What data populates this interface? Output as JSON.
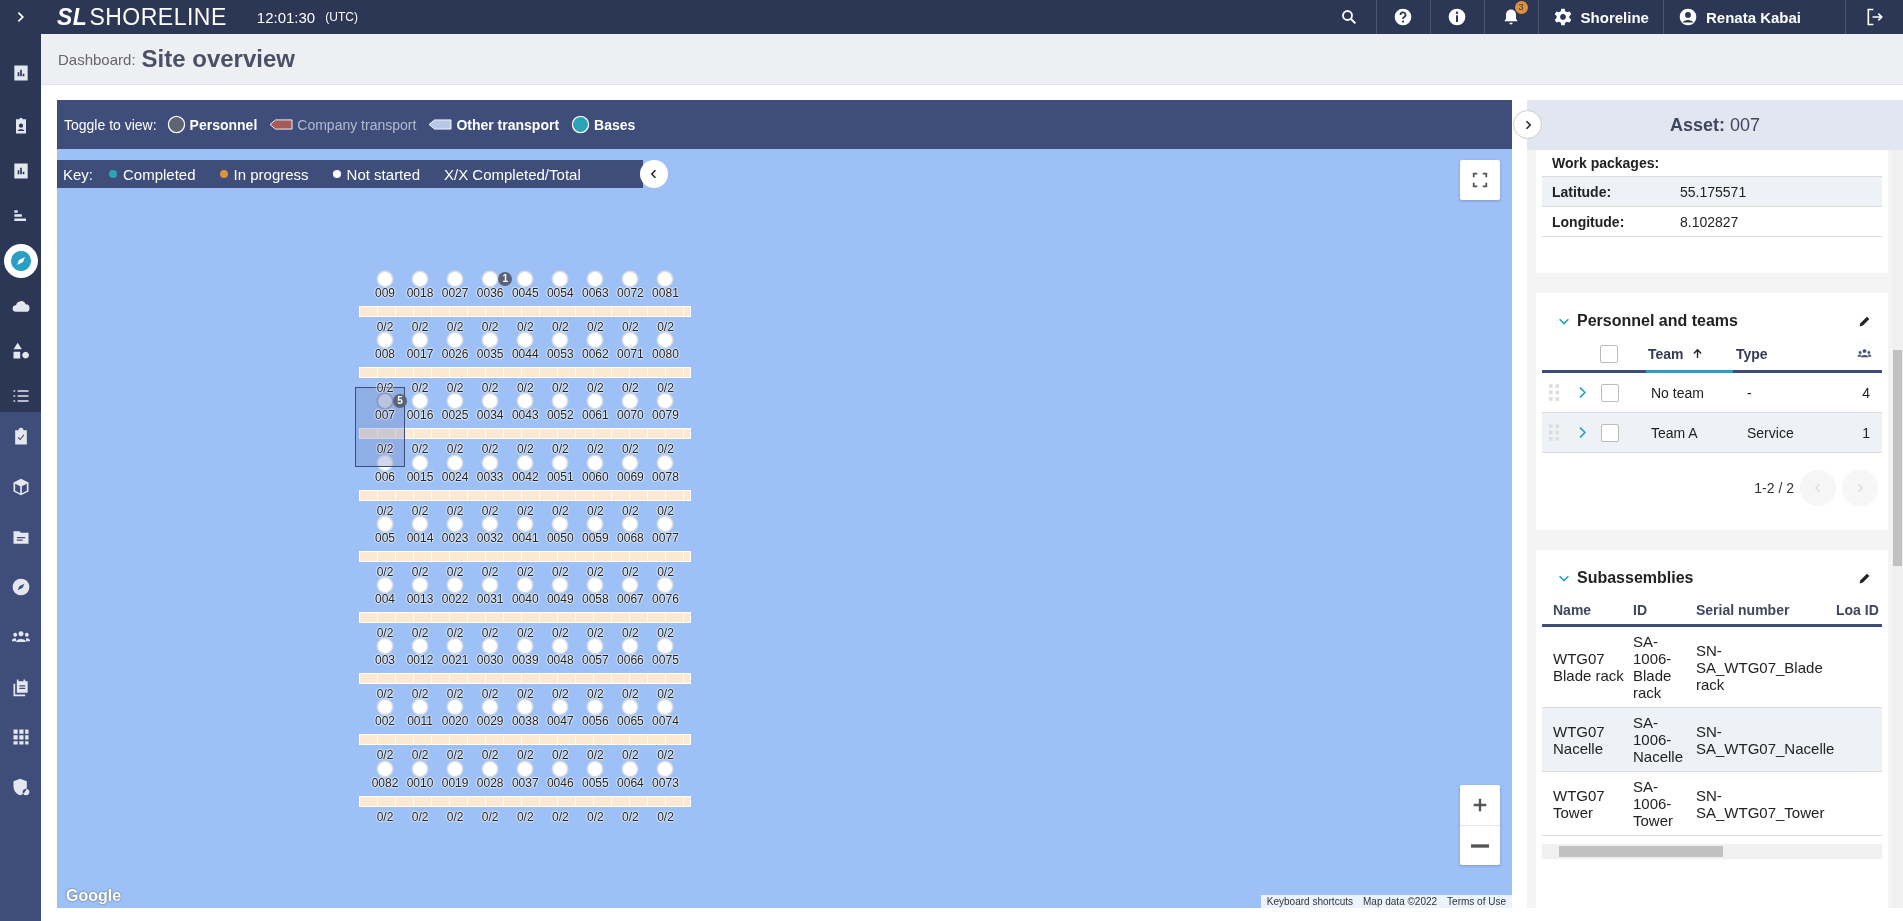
{
  "topbar": {
    "logo_mark": "SL",
    "logo_text": "SHORELINE",
    "time": "12:01:30",
    "timezone": "(UTC)",
    "notifications_count": "3",
    "organization": "Shoreline",
    "user": "Renata Kabai"
  },
  "page_header": {
    "breadcrumb": "Dashboard:",
    "title": "Site overview"
  },
  "sidebar": {
    "items": [
      {
        "selected": false
      },
      {
        "selected": false
      },
      {
        "selected": false
      },
      {
        "selected": false
      },
      {
        "selected": true
      },
      {
        "selected": false
      },
      {
        "selected": false
      },
      {
        "selected": false
      },
      {
        "selected": false
      },
      {
        "selected": false
      },
      {
        "selected": false
      },
      {
        "selected": false
      },
      {
        "selected": false
      },
      {
        "selected": false
      },
      {
        "selected": false
      },
      {
        "selected": false
      }
    ]
  },
  "map_toolbar": {
    "label": "Toggle to view:",
    "toggles": [
      {
        "label": "Personnel",
        "kind": "circle",
        "color": "#5f6473",
        "on": true
      },
      {
        "label": "Company transport",
        "kind": "arrow",
        "color": "#a85a5a",
        "on": false
      },
      {
        "label": "Other transport",
        "kind": "arrow",
        "color": "#b8c7e6",
        "on": true
      },
      {
        "label": "Bases",
        "kind": "circle",
        "color": "#2aa3b4",
        "on": true
      }
    ]
  },
  "map": {
    "key": {
      "label": "Key:",
      "items": [
        {
          "label": "Completed",
          "color": "#2aa3b4"
        },
        {
          "label": "In progress",
          "color": "#e0923a"
        },
        {
          "label": "Not started",
          "color": "#ffffff"
        }
      ],
      "note": "X/X Completed/Total"
    },
    "rows": [
      {
        "turbines": [
          {
            "id": "009",
            "count": "0/2",
            "selected": false
          },
          {
            "id": "0018",
            "count": "0/2",
            "selected": false
          },
          {
            "id": "0027",
            "count": "0/2",
            "selected": false
          },
          {
            "id": "0036",
            "count": "0/2",
            "selected": false,
            "badge": "1"
          },
          {
            "id": "0045",
            "count": "0/2",
            "selected": false
          },
          {
            "id": "0054",
            "count": "0/2",
            "selected": false
          },
          {
            "id": "0063",
            "count": "0/2",
            "selected": false
          },
          {
            "id": "0072",
            "count": "0/2",
            "selected": false
          },
          {
            "id": "0081",
            "count": "0/2",
            "selected": false
          }
        ]
      },
      {
        "turbines": [
          {
            "id": "008",
            "count": "0/2",
            "selected": false
          },
          {
            "id": "0017",
            "count": "0/2",
            "selected": false
          },
          {
            "id": "0026",
            "count": "0/2",
            "selected": false
          },
          {
            "id": "0035",
            "count": "0/2",
            "selected": false
          },
          {
            "id": "0044",
            "count": "0/2",
            "selected": false
          },
          {
            "id": "0053",
            "count": "0/2",
            "selected": false
          },
          {
            "id": "0062",
            "count": "0/2",
            "selected": false
          },
          {
            "id": "0071",
            "count": "0/2",
            "selected": false
          },
          {
            "id": "0080",
            "count": "0/2",
            "selected": false
          }
        ]
      },
      {
        "turbines": [
          {
            "id": "007",
            "count": "0/2",
            "selected": true,
            "badge": "5"
          },
          {
            "id": "0016",
            "count": "0/2",
            "selected": false
          },
          {
            "id": "0025",
            "count": "0/2",
            "selected": false
          },
          {
            "id": "0034",
            "count": "0/2",
            "selected": false
          },
          {
            "id": "0043",
            "count": "0/2",
            "selected": false
          },
          {
            "id": "0052",
            "count": "0/2",
            "selected": false
          },
          {
            "id": "0061",
            "count": "0/2",
            "selected": false
          },
          {
            "id": "0070",
            "count": "0/2",
            "selected": false
          },
          {
            "id": "0079",
            "count": "0/2",
            "selected": false
          }
        ]
      },
      {
        "turbines": [
          {
            "id": "006",
            "count": "0/2",
            "selected": false
          },
          {
            "id": "0015",
            "count": "0/2",
            "selected": false
          },
          {
            "id": "0024",
            "count": "0/2",
            "selected": false
          },
          {
            "id": "0033",
            "count": "0/2",
            "selected": false
          },
          {
            "id": "0042",
            "count": "0/2",
            "selected": false
          },
          {
            "id": "0051",
            "count": "0/2",
            "selected": false
          },
          {
            "id": "0060",
            "count": "0/2",
            "selected": false
          },
          {
            "id": "0069",
            "count": "0/2",
            "selected": false
          },
          {
            "id": "0078",
            "count": "0/2",
            "selected": false
          }
        ]
      },
      {
        "turbines": [
          {
            "id": "005",
            "count": "0/2",
            "selected": false
          },
          {
            "id": "0014",
            "count": "0/2",
            "selected": false
          },
          {
            "id": "0023",
            "count": "0/2",
            "selected": false
          },
          {
            "id": "0032",
            "count": "0/2",
            "selected": false
          },
          {
            "id": "0041",
            "count": "0/2",
            "selected": false
          },
          {
            "id": "0050",
            "count": "0/2",
            "selected": false
          },
          {
            "id": "0059",
            "count": "0/2",
            "selected": false
          },
          {
            "id": "0068",
            "count": "0/2",
            "selected": false
          },
          {
            "id": "0077",
            "count": "0/2",
            "selected": false
          }
        ]
      },
      {
        "turbines": [
          {
            "id": "004",
            "count": "0/2",
            "selected": false
          },
          {
            "id": "0013",
            "count": "0/2",
            "selected": false
          },
          {
            "id": "0022",
            "count": "0/2",
            "selected": false
          },
          {
            "id": "0031",
            "count": "0/2",
            "selected": false
          },
          {
            "id": "0040",
            "count": "0/2",
            "selected": false
          },
          {
            "id": "0049",
            "count": "0/2",
            "selected": false
          },
          {
            "id": "0058",
            "count": "0/2",
            "selected": false
          },
          {
            "id": "0067",
            "count": "0/2",
            "selected": false
          },
          {
            "id": "0076",
            "count": "0/2",
            "selected": false
          }
        ]
      },
      {
        "turbines": [
          {
            "id": "003",
            "count": "0/2",
            "selected": false
          },
          {
            "id": "0012",
            "count": "0/2",
            "selected": false
          },
          {
            "id": "0021",
            "count": "0/2",
            "selected": false
          },
          {
            "id": "0030",
            "count": "0/2",
            "selected": false
          },
          {
            "id": "0039",
            "count": "0/2",
            "selected": false
          },
          {
            "id": "0048",
            "count": "0/2",
            "selected": false
          },
          {
            "id": "0057",
            "count": "0/2",
            "selected": false
          },
          {
            "id": "0066",
            "count": "0/2",
            "selected": false
          },
          {
            "id": "0075",
            "count": "0/2",
            "selected": false
          }
        ]
      },
      {
        "turbines": [
          {
            "id": "002",
            "count": "0/2",
            "selected": false
          },
          {
            "id": "0011",
            "count": "0/2",
            "selected": false
          },
          {
            "id": "0020",
            "count": "0/2",
            "selected": false
          },
          {
            "id": "0029",
            "count": "0/2",
            "selected": false
          },
          {
            "id": "0038",
            "count": "0/2",
            "selected": false
          },
          {
            "id": "0047",
            "count": "0/2",
            "selected": false
          },
          {
            "id": "0056",
            "count": "0/2",
            "selected": false
          },
          {
            "id": "0065",
            "count": "0/2",
            "selected": false
          },
          {
            "id": "0074",
            "count": "0/2",
            "selected": false
          }
        ]
      },
      {
        "turbines": [
          {
            "id": "0082",
            "count": "0/2",
            "selected": false
          },
          {
            "id": "0010",
            "count": "0/2",
            "selected": false
          },
          {
            "id": "0019",
            "count": "0/2",
            "selected": false
          },
          {
            "id": "0028",
            "count": "0/2",
            "selected": false
          },
          {
            "id": "0037",
            "count": "0/2",
            "selected": false
          },
          {
            "id": "0046",
            "count": "0/2",
            "selected": false
          },
          {
            "id": "0055",
            "count": "0/2",
            "selected": false
          },
          {
            "id": "0064",
            "count": "0/2",
            "selected": false
          },
          {
            "id": "0073",
            "count": "0/2",
            "selected": false
          }
        ]
      }
    ],
    "provider": "Google",
    "attribution": [
      "Keyboard shortcuts",
      "Map data ©2022",
      "Terms of Use"
    ]
  },
  "asset_panel": {
    "title_label": "Asset:",
    "title_value": "007",
    "details": [
      {
        "label": "Work packages:"
      },
      {
        "label": "Latitude:",
        "value": "55.175571"
      },
      {
        "label": "Longitude:",
        "value": "8.102827"
      }
    ]
  },
  "personnel": {
    "title": "Personnel and teams",
    "expanded": true,
    "all_checked": false,
    "columns": [
      "Team",
      "Type"
    ],
    "rows": [
      {
        "team": "No team",
        "type": "-",
        "count": "4",
        "checked": false,
        "expanded": false
      },
      {
        "team": "Team A",
        "type": "Service",
        "count": "1",
        "checked": false,
        "expanded": false
      }
    ],
    "pagination": "1-2 / 2"
  },
  "subassemblies": {
    "title": "Subassemblies",
    "expanded": true,
    "columns": [
      "Name",
      "ID",
      "Serial number",
      "Loa ID"
    ],
    "rows": [
      {
        "cells": [
          "WTG07 Blade rack",
          "SA-1006-Blade rack",
          "SN-SA_WTG07_Blade rack"
        ]
      },
      {
        "cells": [
          "WTG07 Nacelle",
          "SA-1006-Nacelle",
          "SN-SA_WTG07_Nacelle"
        ]
      },
      {
        "cells": [
          "WTG07 Tower",
          "SA-1006-Tower",
          "SN-SA_WTG07_Tower"
        ]
      }
    ]
  }
}
